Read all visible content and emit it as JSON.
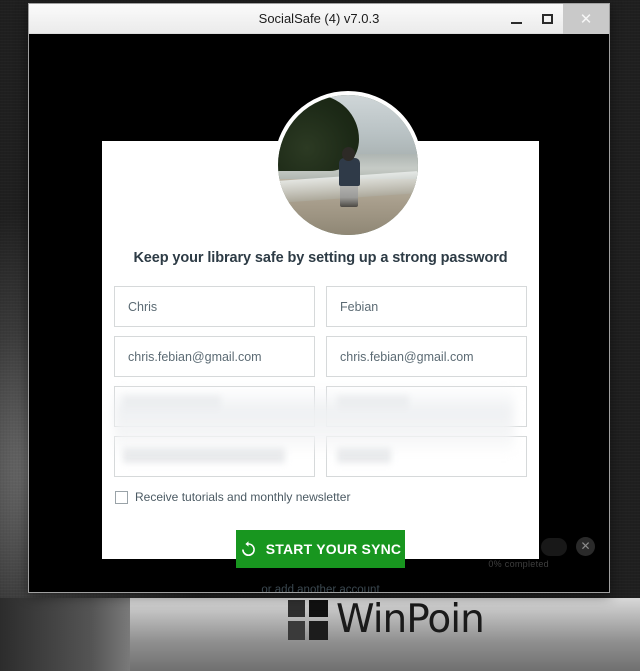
{
  "window": {
    "title": "SocialSafe (4) v7.0.3",
    "app_icon": "droplet-icon",
    "buttons": {
      "minimize": "–",
      "maximize": "□",
      "close": "✕"
    }
  },
  "background_app": {
    "progress_text": "0% completed",
    "close_icon": "✕"
  },
  "card": {
    "heading": "Keep your library safe by setting up a strong password",
    "fields": [
      {
        "name": "first-name-field",
        "value": "Chris",
        "masked": false
      },
      {
        "name": "last-name-field",
        "value": "Febian",
        "masked": false
      },
      {
        "name": "email-field",
        "value": "chris.febian@gmail.com",
        "masked": false
      },
      {
        "name": "confirm-email-field",
        "value": "chris.febian@gmail.com",
        "masked": false
      },
      {
        "name": "password-field",
        "value": "",
        "masked": true
      },
      {
        "name": "confirm-password-field",
        "value": "",
        "masked": true
      },
      {
        "name": "password-hint-field",
        "value": "",
        "masked": true
      },
      {
        "name": "password-hint-confirm-field",
        "value": "",
        "masked": true
      }
    ],
    "newsletter_label": "Receive tutorials and monthly newsletter",
    "newsletter_checked": false,
    "primary_button": "START YOUR SYNC",
    "primary_button_icon": "sync-refresh-icon",
    "secondary_link": "or add another account"
  },
  "watermark": {
    "text": "WinPoin",
    "logo": "windows-squares-logo"
  },
  "colors": {
    "primary_green": "#18961f",
    "heading_text": "#2d3b45",
    "field_border": "#d6d9da",
    "titlebar": "#f2f2f2",
    "app_backdrop": "#000000"
  }
}
